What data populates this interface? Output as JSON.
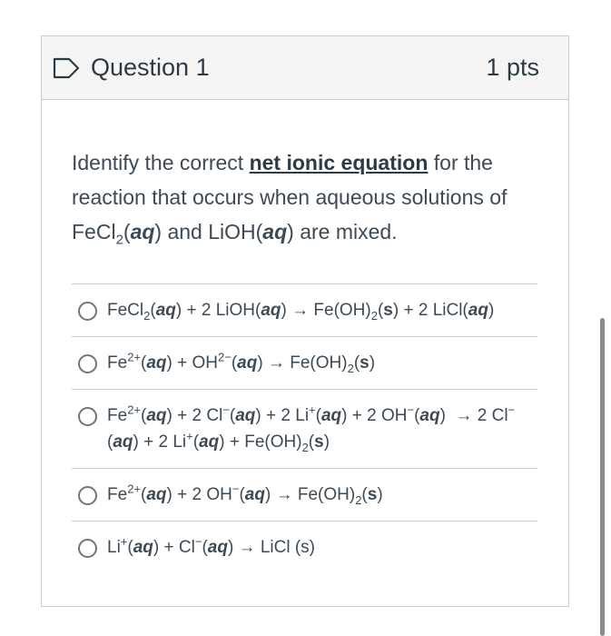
{
  "question": {
    "title": "Question 1",
    "points": "1 pts"
  },
  "prompt": {
    "text_before": "Identify the correct ",
    "link": "net ionic equation",
    "text_after_link": " for the reaction that occurs when aqueous solutions of FeCl",
    "sub2": "2",
    "aq": "aq",
    "mid": ") and LiOH(",
    "end": ") are mixed."
  },
  "options": [
    {
      "html": "FeCl<sub>2</sub>(<b><i>aq</i></b>) + 2 LiOH(<b><i>aq</i></b>) → Fe(OH)<sub>2</sub>(<b>s</b>) + 2 LiCl(<b><i>aq</i></b>)"
    },
    {
      "html": "Fe<sup>2+</sup>(<b><i>aq</i></b>) + OH<sup>2−</sup>(<b><i>aq</i></b>) → Fe(OH)<sub>2</sub>(<b>s</b>)"
    },
    {
      "html": "Fe<sup>2+</sup>(<b><i>aq</i></b>) + 2 Cl<sup>−</sup>(<b><i>aq</i></b>) + 2 Li<sup>+</sup>(<b><i>aq</i></b>) + 2 OH<sup>−</sup>(<b><i>aq</i></b>) &nbsp;→ 2 Cl<sup>−</sup>(<b><i>aq</i></b>) + 2 Li<sup>+</sup>(<b><i>aq</i></b>) + Fe(OH)<sub>2</sub>(<b>s</b>)"
    },
    {
      "html": "Fe<sup>2+</sup>(<b><i>aq</i></b>) + 2 OH<sup>−</sup>(<b><i>aq</i></b>) → Fe(OH)<sub>2</sub>(<b>s</b>)"
    },
    {
      "html": "Li<sup>+</sup>(<b><i>aq</i></b>) + Cl<sup>−</sup>(<b><i>aq</i></b>) → LiCl (s)"
    }
  ],
  "colors": {
    "header_bg": "#f5f5f5",
    "border": "#c7cdd1",
    "text": "#2d3b45",
    "flag": "#2d3b45"
  },
  "icons": {
    "flag": "flag-outline-icon",
    "radio": "radio-empty-icon"
  }
}
